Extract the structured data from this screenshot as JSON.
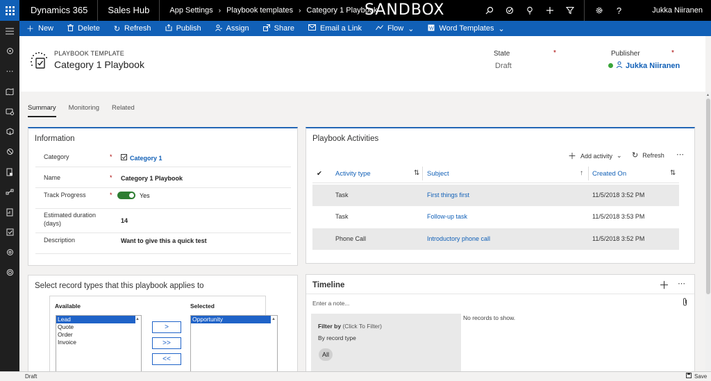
{
  "topbar": {
    "brand": "Dynamics 365",
    "app": "Sales Hub",
    "breadcrumbs": [
      "App Settings",
      "Playbook templates",
      "Category 1 Playbook"
    ],
    "environment": "SANDBOX",
    "user": "Jukka Niiranen",
    "icons": [
      "search-icon",
      "task-icon",
      "lightbulb-icon",
      "plus-icon",
      "filter-icon",
      "gear-icon",
      "help-icon"
    ]
  },
  "commands": [
    {
      "label": "New",
      "icon": "plus-icon"
    },
    {
      "label": "Delete",
      "icon": "trash-icon"
    },
    {
      "label": "Refresh",
      "icon": "refresh-icon"
    },
    {
      "label": "Publish",
      "icon": "publish-icon"
    },
    {
      "label": "Assign",
      "icon": "assign-icon"
    },
    {
      "label": "Share",
      "icon": "share-icon"
    },
    {
      "label": "Email a Link",
      "icon": "email-icon"
    },
    {
      "label": "Flow",
      "icon": "flow-icon"
    },
    {
      "label": "Word Templates",
      "icon": "word-icon"
    }
  ],
  "header": {
    "entity_type": "PLAYBOOK TEMPLATE",
    "record_name": "Category 1 Playbook",
    "state_label": "State",
    "state_value": "Draft",
    "publisher_label": "Publisher",
    "publisher_value": "Jukka Niiranen",
    "required_marker": "*"
  },
  "tabs": [
    "Summary",
    "Monitoring",
    "Related"
  ],
  "information": {
    "title": "Information",
    "fields": [
      {
        "label": "Category",
        "value": "Category 1",
        "required": "*"
      },
      {
        "label": "Name",
        "value": "Category 1 Playbook",
        "required": "*"
      },
      {
        "label": "Track Progress",
        "value": "Yes",
        "required": "*"
      },
      {
        "label": "Estimated duration",
        "label2": "(days)",
        "value": "14",
        "required": ""
      },
      {
        "label": "Description",
        "value": "Want to give this a quick test",
        "required": ""
      }
    ]
  },
  "activities": {
    "title": "Playbook Activities",
    "add_activity": "Add activity",
    "refresh": "Refresh",
    "columns": [
      "Activity type",
      "Subject",
      "Created On"
    ],
    "rows": [
      [
        "Task",
        "First things first",
        "11/5/2018 3:52 PM"
      ],
      [
        "Task",
        "Follow-up task",
        "11/5/2018 3:53 PM"
      ],
      [
        "Phone Call",
        "Introductory phone call",
        "11/5/2018 3:52 PM"
      ]
    ]
  },
  "record_types": {
    "title": "Select record types that this playbook applies to",
    "available_label": "Available",
    "selected_label": "Selected",
    "available": [
      "Lead",
      "Quote",
      "Order",
      "Invoice"
    ],
    "selected": [
      "Opportunity"
    ],
    "buttons": [
      ">",
      ">>",
      "<<"
    ]
  },
  "timeline": {
    "title": "Timeline",
    "note_placeholder": "Enter a note...",
    "filter_by": "Filter by",
    "filter_hint": "(Click To Filter)",
    "by_record_type": "By record type",
    "all": "All",
    "no_records": "No records to show."
  },
  "footer": {
    "status": "Draft",
    "save": "Save"
  }
}
